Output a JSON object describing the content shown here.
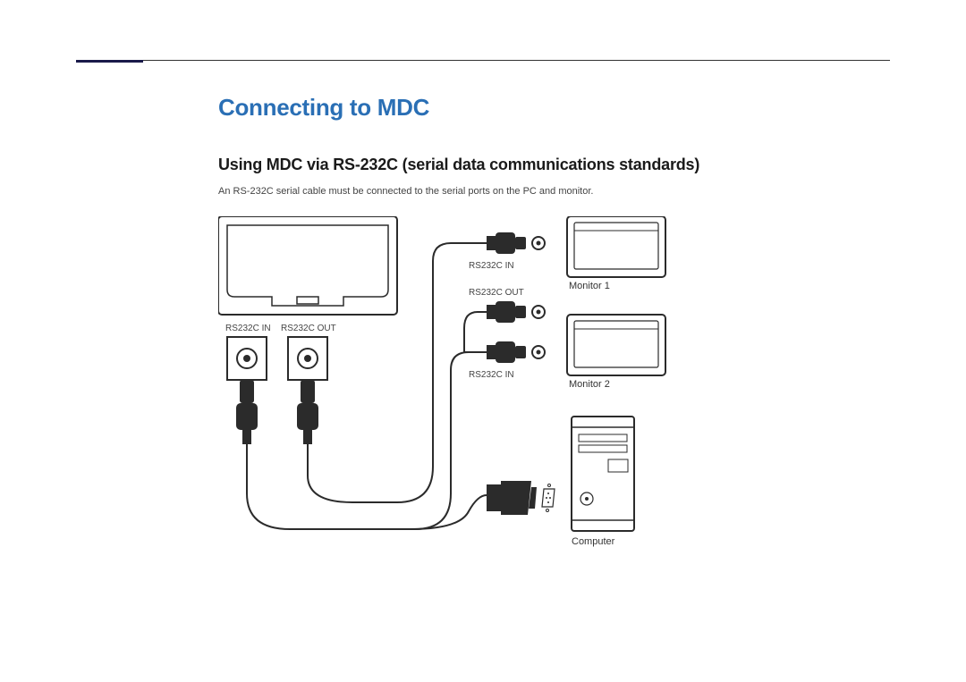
{
  "page": {
    "title": "Connecting to MDC",
    "subtitle": "Using MDC via RS-232C (serial data communications standards)",
    "body": "An RS-232C serial cable must be connected to the serial ports on the PC and monitor."
  },
  "labels": {
    "panel_port_in": "RS232C IN",
    "panel_port_out": "RS232C OUT",
    "conn1_in": "RS232C IN",
    "conn2_out": "RS232C OUT",
    "conn3_in": "RS232C IN",
    "monitor1": "Monitor 1",
    "monitor2": "Monitor 2",
    "computer": "Computer"
  }
}
